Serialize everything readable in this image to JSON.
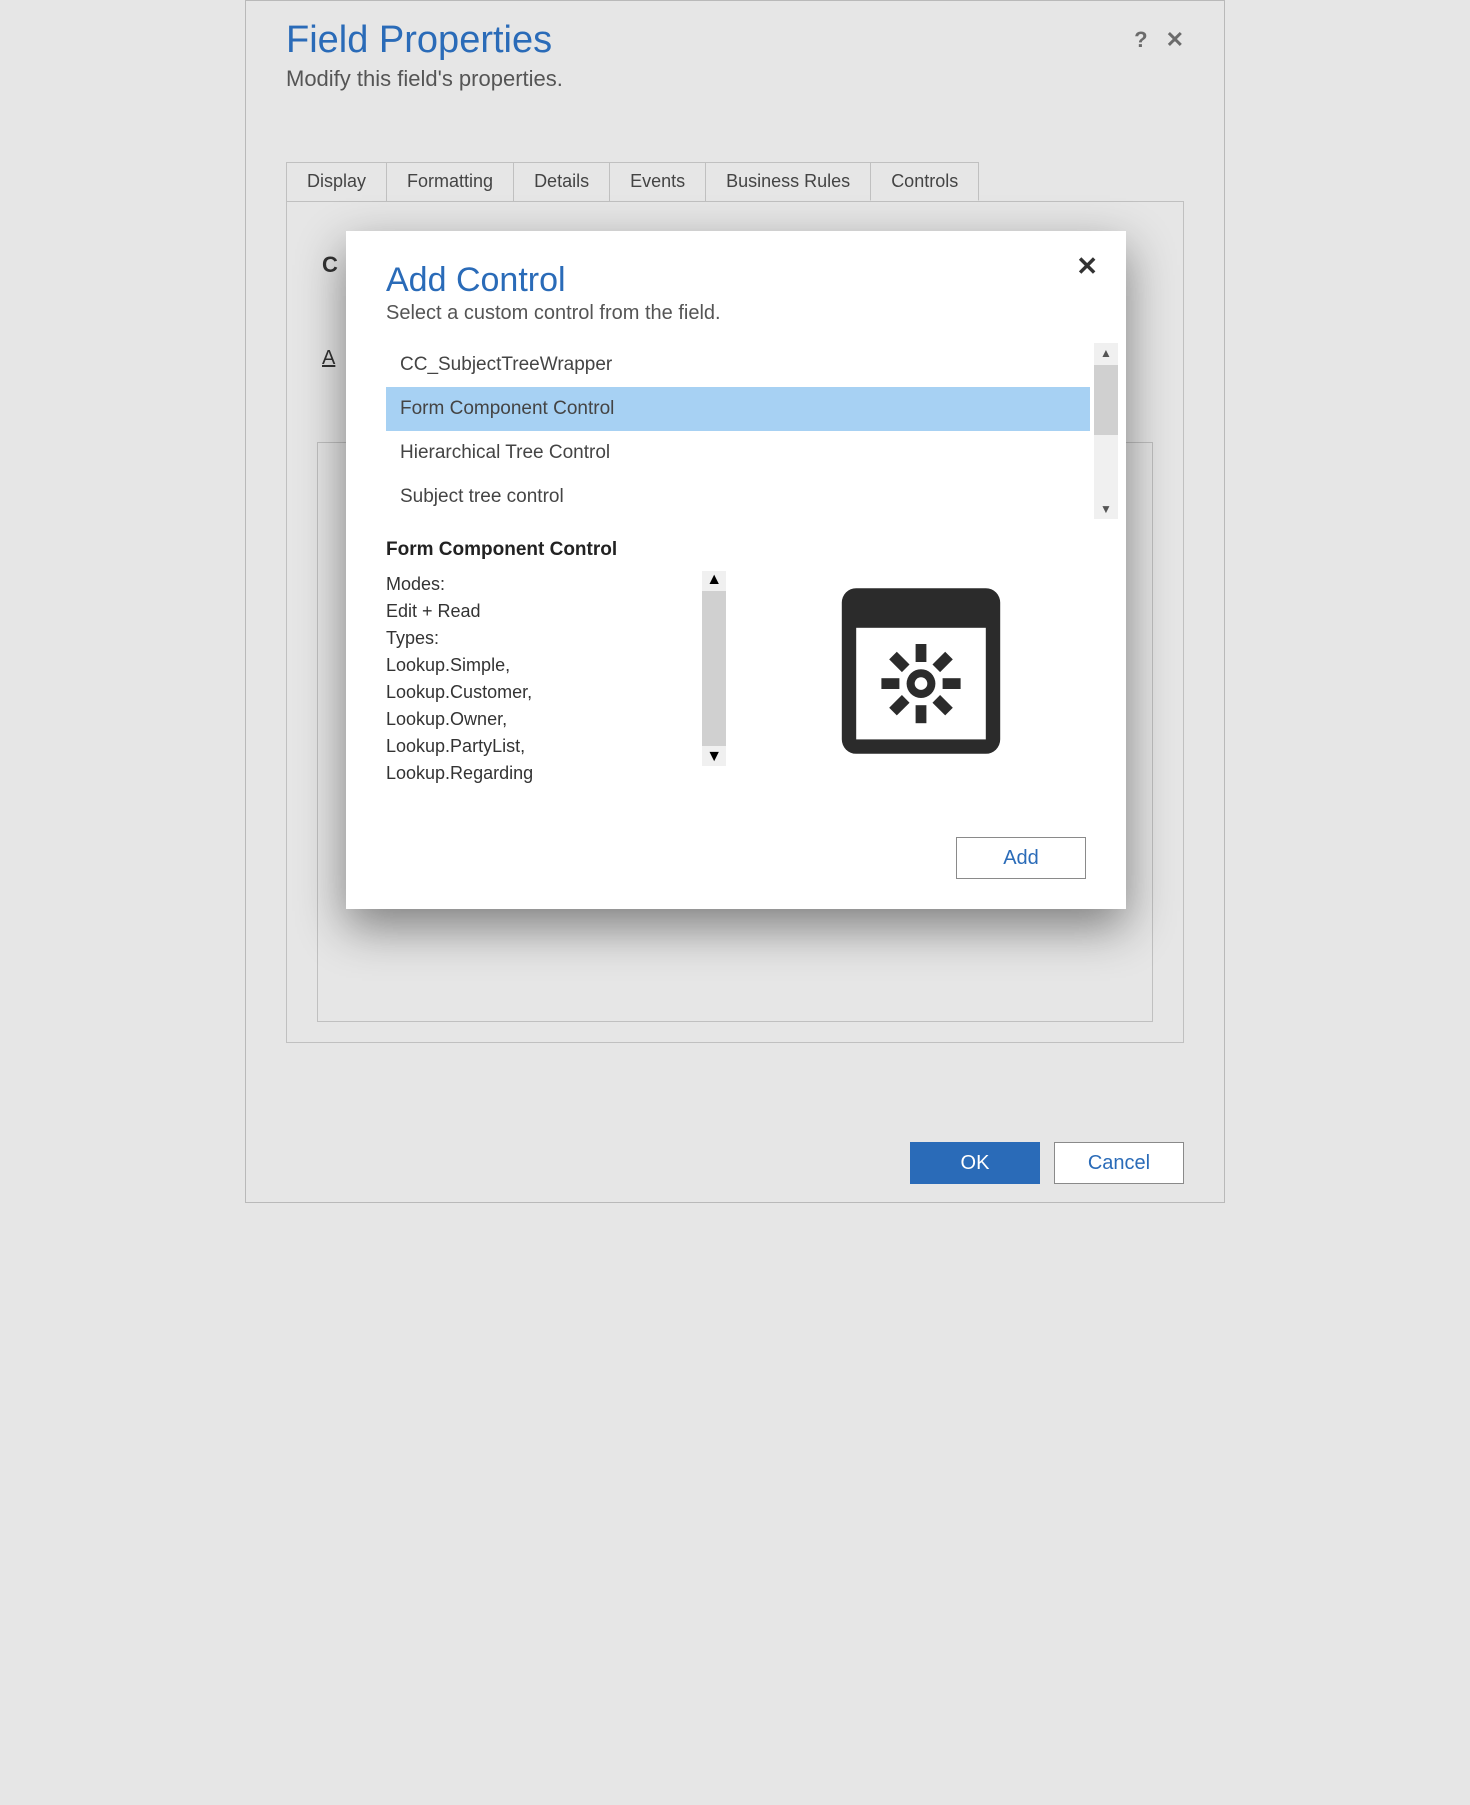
{
  "header": {
    "title": "Field Properties",
    "subtitle": "Modify this field's properties.",
    "help_icon": "?",
    "close_icon": "✕"
  },
  "tabs": [
    "Display",
    "Formatting",
    "Details",
    "Events",
    "Business Rules",
    "Controls"
  ],
  "active_tab_index": 5,
  "panel": {
    "partial_char": "C",
    "partial_link": "A"
  },
  "footer": {
    "ok": "OK",
    "cancel": "Cancel"
  },
  "modal": {
    "title": "Add Control",
    "subtitle": "Select a custom control from the field.",
    "close_icon": "✕",
    "items": [
      "CC_SubjectTreeWrapper",
      "Form Component Control",
      "Hierarchical Tree Control",
      "Subject tree control"
    ],
    "selected_index": 1,
    "selected_name": "Form Component Control",
    "detail": {
      "modes_label": "Modes:",
      "modes_value": "Edit + Read",
      "types_label": "Types:",
      "types_value": "Lookup.Simple, Lookup.Customer, Lookup.Owner, Lookup.PartyList, Lookup.Regarding"
    },
    "add_button": "Add"
  }
}
